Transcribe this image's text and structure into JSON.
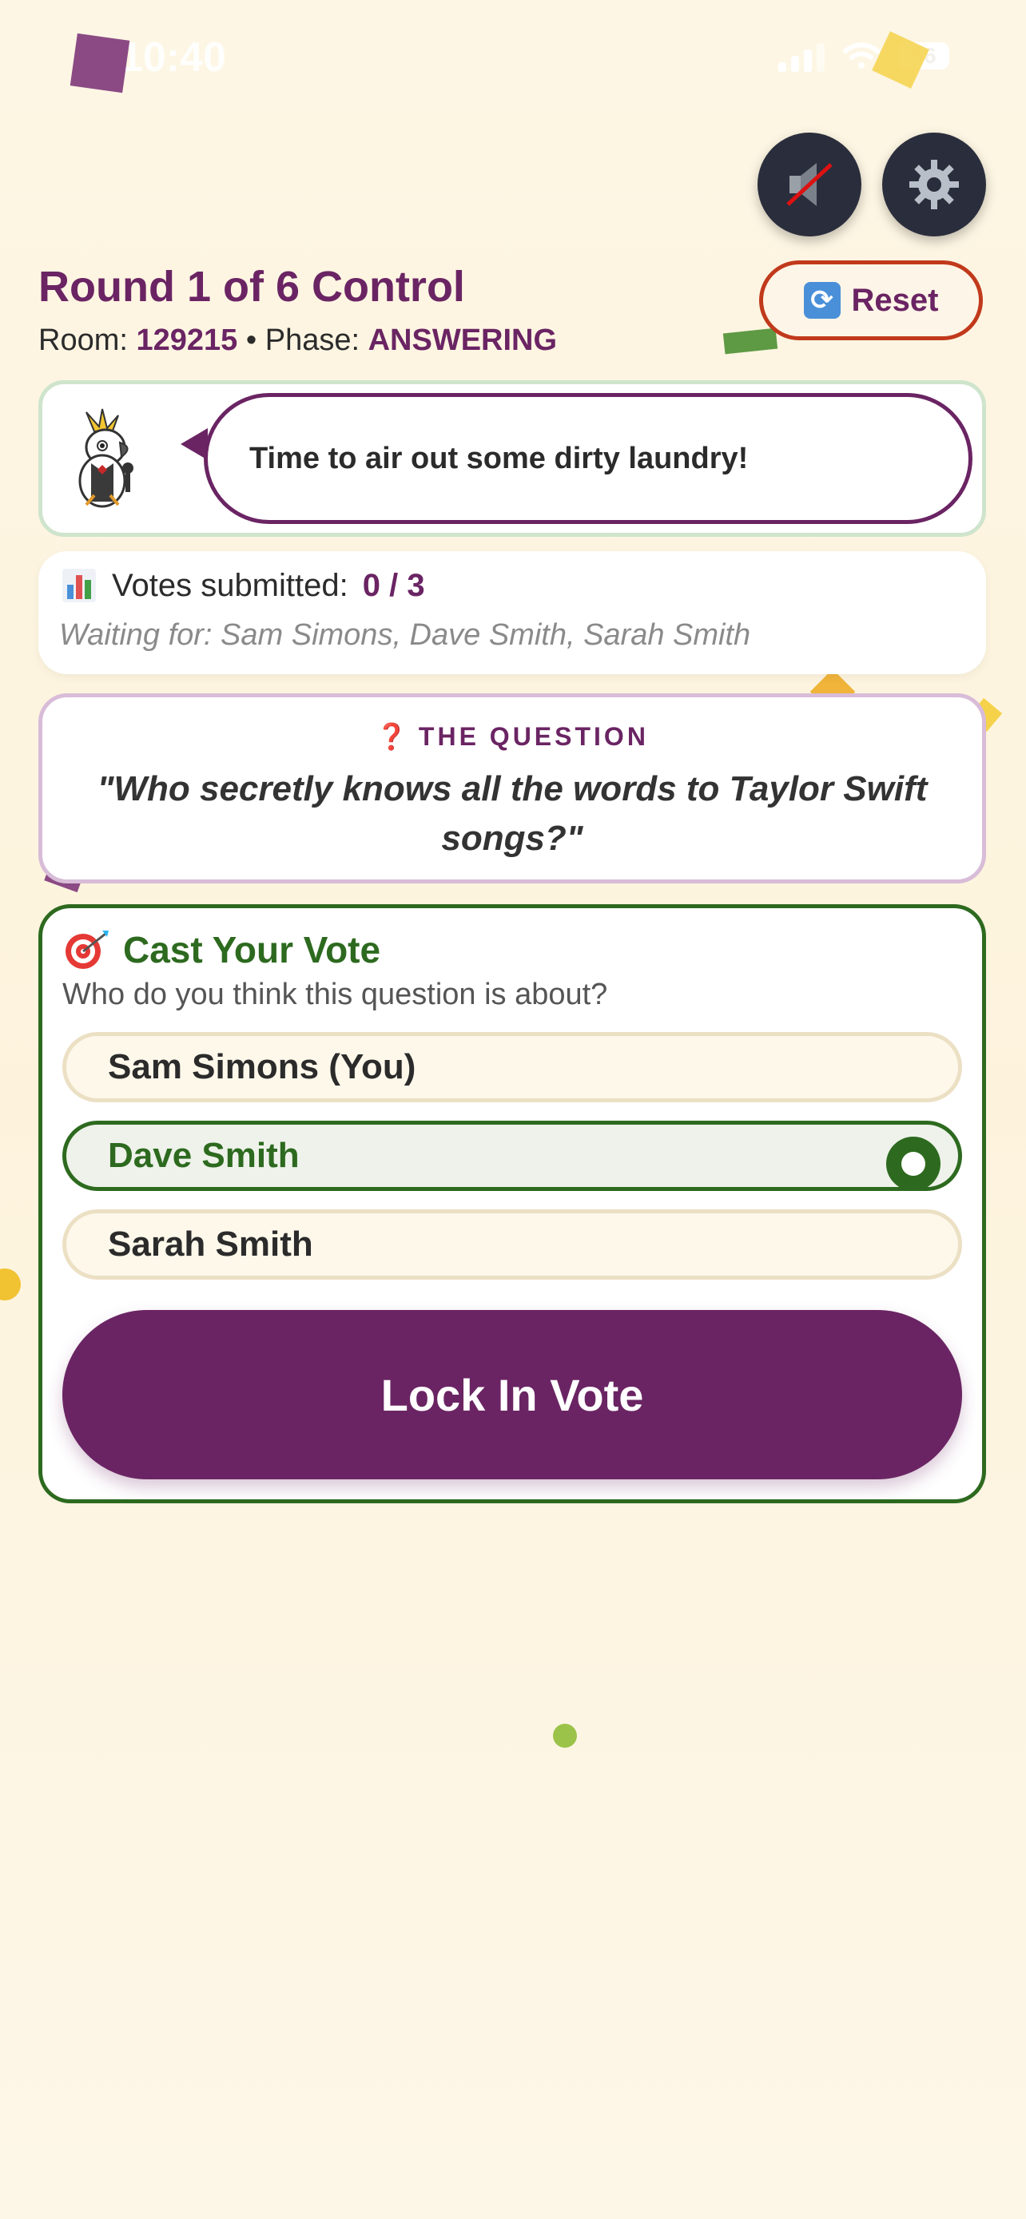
{
  "status_bar": {
    "time": "10:40",
    "battery": "56"
  },
  "controls": {
    "mute_icon": "speaker-muted-icon",
    "settings_icon": "gear-icon"
  },
  "header": {
    "title": "Round 1 of 6 Control",
    "room_label": "Room:",
    "room_code": "129215",
    "separator": "•",
    "phase_label": "Phase:",
    "phase_value": "ANSWERING",
    "reset_label": "Reset"
  },
  "host": {
    "message": "Time to air out some dirty laundry!"
  },
  "votes": {
    "label": "Votes submitted:",
    "count": "0 / 3",
    "waiting": "Waiting for: Sam Simons, Dave Smith, Sarah Smith"
  },
  "question": {
    "label": "THE QUESTION",
    "text": "\"Who secretly knows all the words to Taylor Swift songs?\""
  },
  "vote": {
    "title": "Cast Your Vote",
    "subtitle": "Who do you think this question is about?",
    "options": [
      {
        "label": "Sam Simons (You)",
        "selected": false
      },
      {
        "label": "Dave Smith",
        "selected": true
      },
      {
        "label": "Sarah Smith",
        "selected": false
      }
    ],
    "submit_label": "Lock In Vote"
  },
  "colors": {
    "brand_purple": "#6a2463",
    "accent_green": "#2d6a1f",
    "reset_red": "#c1391b"
  }
}
